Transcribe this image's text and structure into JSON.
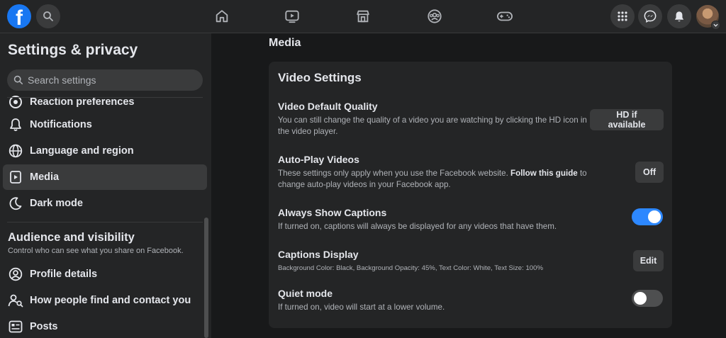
{
  "header": {
    "logo_letter": "f",
    "nav": [
      "home-icon",
      "watch-icon",
      "marketplace-icon",
      "groups-icon",
      "gaming-icon"
    ],
    "right": [
      "menu-icon",
      "messenger-icon",
      "notifications-icon",
      "avatar"
    ]
  },
  "sidebar": {
    "title": "Settings & privacy",
    "search_placeholder": "Search settings",
    "items": [
      {
        "label": "Reaction preferences",
        "icon": "reaction-icon"
      },
      {
        "label": "Notifications",
        "icon": "bell-icon"
      },
      {
        "label": "Language and region",
        "icon": "globe-icon"
      },
      {
        "label": "Media",
        "icon": "media-icon",
        "active": true
      },
      {
        "label": "Dark mode",
        "icon": "moon-icon"
      }
    ],
    "section": {
      "title": "Audience and visibility",
      "description": "Control who can see what you share on Facebook."
    },
    "section_items": [
      {
        "label": "Profile details",
        "icon": "profile-icon"
      },
      {
        "label": "How people find and contact you",
        "icon": "find-contact-icon"
      },
      {
        "label": "Posts",
        "icon": "posts-icon"
      }
    ]
  },
  "main": {
    "heading": "Media",
    "card_title": "Video Settings",
    "settings": {
      "quality": {
        "title": "Video Default Quality",
        "description": "You can still change the quality of a video you are watching by clicking the HD icon in the video player.",
        "button": "HD if available"
      },
      "autoplay": {
        "title": "Auto-Play Videos",
        "desc_before": "These settings only apply when you use the Facebook website. ",
        "desc_link": "Follow this guide",
        "desc_after": " to change auto-play videos in your Facebook app.",
        "button": "Off"
      },
      "captions": {
        "title": "Always Show Captions",
        "description": "If turned on, captions will always be displayed for any videos that have them.",
        "enabled": true
      },
      "captions_display": {
        "title": "Captions Display",
        "description": "Background Color: Black, Background Opacity: 45%, Text Color: White, Text Size: 100%",
        "button": "Edit"
      },
      "quiet": {
        "title": "Quiet mode",
        "description": "If turned on, video will start at a lower volume.",
        "enabled": false
      }
    }
  },
  "colors": {
    "accent": "#2d88ff",
    "brand": "#1877f2",
    "page_bg": "#18191a",
    "surface": "#242526"
  }
}
